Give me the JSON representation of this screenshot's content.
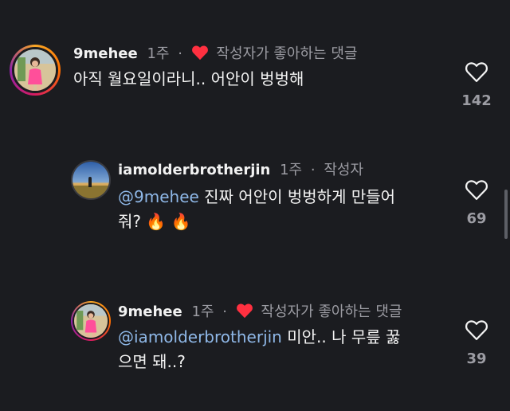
{
  "comments": [
    {
      "username": "9mehee",
      "time": "1주",
      "separator": "·",
      "author_liked_label": "작성자가 좋아하는 댓글",
      "text": "아직 월요일이라니.. 어안이 벙벙해",
      "like_count": "142",
      "avatar_icon": "profile-photo-pink-outfit",
      "has_story_ring": true
    },
    {
      "username": "iamolderbrotherjin",
      "time": "1주",
      "separator": "·",
      "author_label": "작성자",
      "mention": "@9mehee",
      "text_line1": " 진짜 어안이 벙벙하게 만들어",
      "text_line2": "줘? ",
      "emoji": "🔥 🔥",
      "like_count": "69",
      "avatar_icon": "profile-photo-sunset-field"
    },
    {
      "username": "9mehee",
      "time": "1주",
      "separator": "·",
      "author_liked_label": "작성자가 좋아하는 댓글",
      "mention": "@iamolderbrotherjin",
      "text_line1": " 미안.. 나 무릎 꿇",
      "text_line2": "으면 돼..?",
      "like_count": "39",
      "avatar_icon": "profile-photo-pink-outfit"
    }
  ],
  "colors": {
    "background": "#1b1c20",
    "mention": "#8fb8e8",
    "heart_red": "#ff3040",
    "muted": "#9c9ca3"
  }
}
